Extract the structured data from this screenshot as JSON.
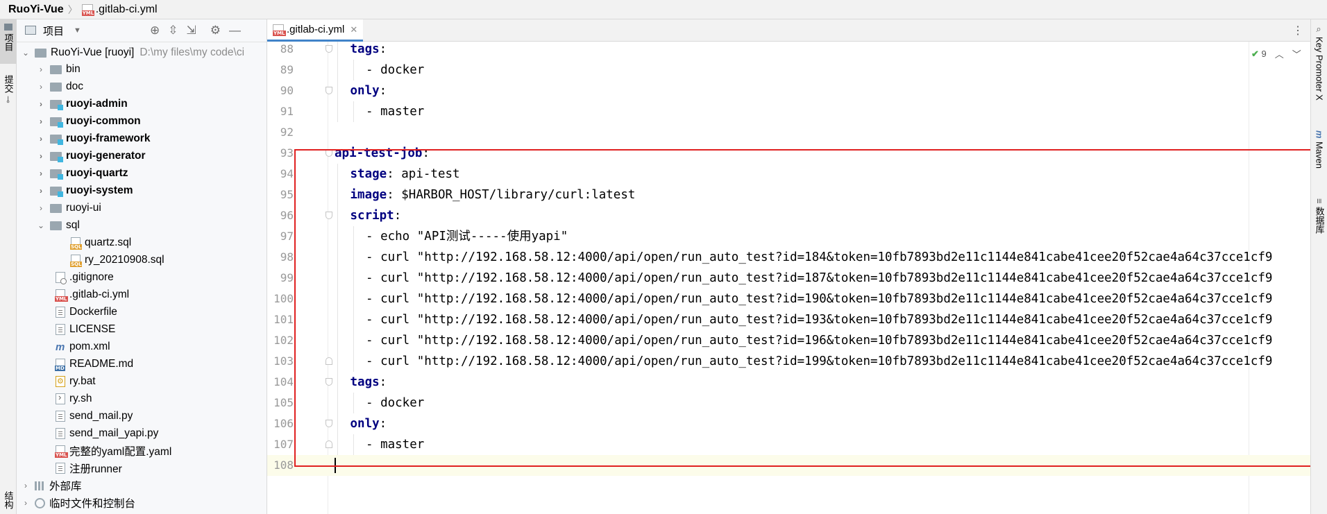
{
  "breadcrumb": {
    "project": "RuoYi-Vue",
    "file": ".gitlab-ci.yml"
  },
  "left_strip": {
    "project_tab": "项目",
    "commit_tab": "提交",
    "structure_tab": "结构"
  },
  "right_strip": {
    "key_promoter": "Key Promoter X",
    "maven": "Maven",
    "database": "数据库"
  },
  "project_panel": {
    "title": "项目",
    "icons": [
      "locate-icon",
      "expand-all-icon",
      "collapse-all-icon",
      "gear-icon",
      "hide-icon"
    ],
    "root": {
      "name": "RuoYi-Vue [ruoyi]",
      "path": "D:\\my files\\my code\\ci"
    },
    "items": [
      {
        "label": "bin",
        "kind": "folder"
      },
      {
        "label": "doc",
        "kind": "folder"
      },
      {
        "label": "ruoyi-admin",
        "kind": "module"
      },
      {
        "label": "ruoyi-common",
        "kind": "module"
      },
      {
        "label": "ruoyi-framework",
        "kind": "module"
      },
      {
        "label": "ruoyi-generator",
        "kind": "module"
      },
      {
        "label": "ruoyi-quartz",
        "kind": "module"
      },
      {
        "label": "ruoyi-system",
        "kind": "module"
      },
      {
        "label": "ruoyi-ui",
        "kind": "folder"
      },
      {
        "label": "sql",
        "kind": "folder-open"
      },
      {
        "label": "quartz.sql",
        "kind": "sql"
      },
      {
        "label": "ry_20210908.sql",
        "kind": "sql"
      },
      {
        "label": ".gitignore",
        "kind": "git"
      },
      {
        "label": ".gitlab-ci.yml",
        "kind": "yml"
      },
      {
        "label": "Dockerfile",
        "kind": "txt"
      },
      {
        "label": "LICENSE",
        "kind": "txt"
      },
      {
        "label": "pom.xml",
        "kind": "maven"
      },
      {
        "label": "README.md",
        "kind": "md"
      },
      {
        "label": "ry.bat",
        "kind": "bat"
      },
      {
        "label": "ry.sh",
        "kind": "sh"
      },
      {
        "label": "send_mail.py",
        "kind": "txt"
      },
      {
        "label": "send_mail_yapi.py",
        "kind": "txt"
      },
      {
        "label": "完整的yaml配置.yaml",
        "kind": "yml"
      },
      {
        "label": "注册runner",
        "kind": "txt"
      },
      {
        "label": "外部库",
        "kind": "lib"
      },
      {
        "label": "临时文件和控制台",
        "kind": "scratch"
      }
    ]
  },
  "editor": {
    "tab_label": ".gitlab-ci.yml",
    "inspection_count": "9",
    "lines": [
      {
        "n": "88",
        "indent": 1,
        "key": "tags",
        "rest": ":"
      },
      {
        "n": "89",
        "indent": 2,
        "text": "- docker"
      },
      {
        "n": "90",
        "indent": 1,
        "key": "only",
        "rest": ":"
      },
      {
        "n": "91",
        "indent": 2,
        "text": "- master"
      },
      {
        "n": "92",
        "indent": 0,
        "text": ""
      },
      {
        "n": "93",
        "indent": 0,
        "key": "api-test-job",
        "rest": ":"
      },
      {
        "n": "94",
        "indent": 1,
        "key": "stage",
        "rest": ": api-test"
      },
      {
        "n": "95",
        "indent": 1,
        "key": "image",
        "rest": ": $HARBOR_HOST/library/curl:latest"
      },
      {
        "n": "96",
        "indent": 1,
        "key": "script",
        "rest": ":"
      },
      {
        "n": "97",
        "indent": 2,
        "text": "- echo \"API测试-----使用yapi\""
      },
      {
        "n": "98",
        "indent": 2,
        "text": "- curl \"http://192.168.58.12:4000/api/open/run_auto_test?id=184&token=10fb7893bd2e11c1144e841cabe41cee20f52cae4a64c37cce1cf9"
      },
      {
        "n": "99",
        "indent": 2,
        "text": "- curl \"http://192.168.58.12:4000/api/open/run_auto_test?id=187&token=10fb7893bd2e11c1144e841cabe41cee20f52cae4a64c37cce1cf9"
      },
      {
        "n": "100",
        "indent": 2,
        "text": "- curl \"http://192.168.58.12:4000/api/open/run_auto_test?id=190&token=10fb7893bd2e11c1144e841cabe41cee20f52cae4a64c37cce1cf9"
      },
      {
        "n": "101",
        "indent": 2,
        "text": "- curl \"http://192.168.58.12:4000/api/open/run_auto_test?id=193&token=10fb7893bd2e11c1144e841cabe41cee20f52cae4a64c37cce1cf9"
      },
      {
        "n": "102",
        "indent": 2,
        "text": "- curl \"http://192.168.58.12:4000/api/open/run_auto_test?id=196&token=10fb7893bd2e11c1144e841cabe41cee20f52cae4a64c37cce1cf9"
      },
      {
        "n": "103",
        "indent": 2,
        "text": "- curl \"http://192.168.58.12:4000/api/open/run_auto_test?id=199&token=10fb7893bd2e11c1144e841cabe41cee20f52cae4a64c37cce1cf9"
      },
      {
        "n": "104",
        "indent": 1,
        "key": "tags",
        "rest": ":"
      },
      {
        "n": "105",
        "indent": 2,
        "text": "- docker"
      },
      {
        "n": "106",
        "indent": 1,
        "key": "only",
        "rest": ":"
      },
      {
        "n": "107",
        "indent": 2,
        "text": "- master"
      },
      {
        "n": "108",
        "indent": 0,
        "text": ""
      }
    ]
  }
}
